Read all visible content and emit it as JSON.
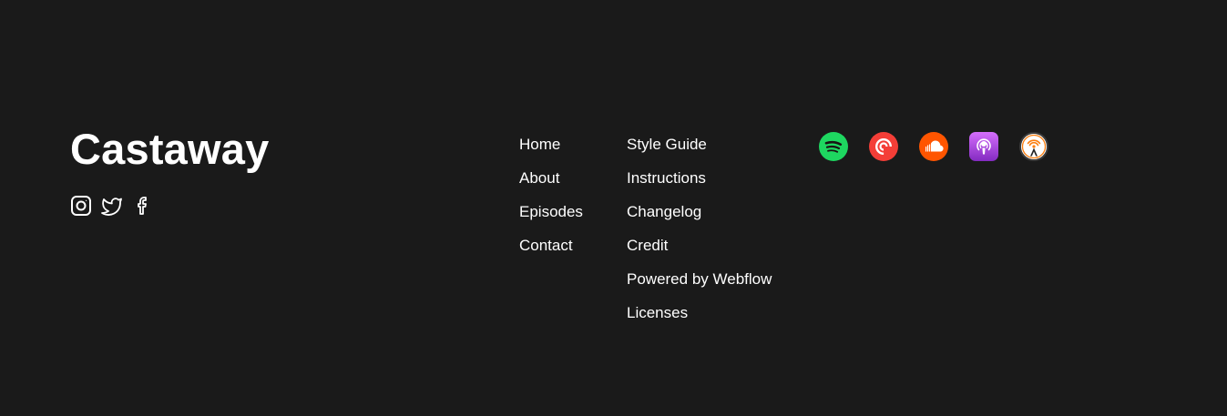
{
  "brand": {
    "name": "Castaway"
  },
  "social_icons": [
    "instagram-icon",
    "twitter-icon",
    "facebook-icon"
  ],
  "nav": {
    "column1": [
      "Home",
      "About",
      "Episodes",
      "Contact"
    ],
    "column2": [
      "Style Guide",
      "Instructions",
      "Changelog",
      "Credit",
      "Powered by Webflow",
      "Licenses"
    ]
  },
  "platforms": [
    {
      "icon": "spotify-icon",
      "color": "#1ed760"
    },
    {
      "icon": "pocket-casts-icon",
      "color": "#f43e37"
    },
    {
      "icon": "soundcloud-icon",
      "color": "#ff5500"
    },
    {
      "icon": "apple-podcasts-icon",
      "color": "#a64ee0"
    },
    {
      "icon": "overcast-icon",
      "color": "#fc7e0f"
    }
  ],
  "colors": {
    "background": "#1a1a1a",
    "text": "#ffffff"
  }
}
